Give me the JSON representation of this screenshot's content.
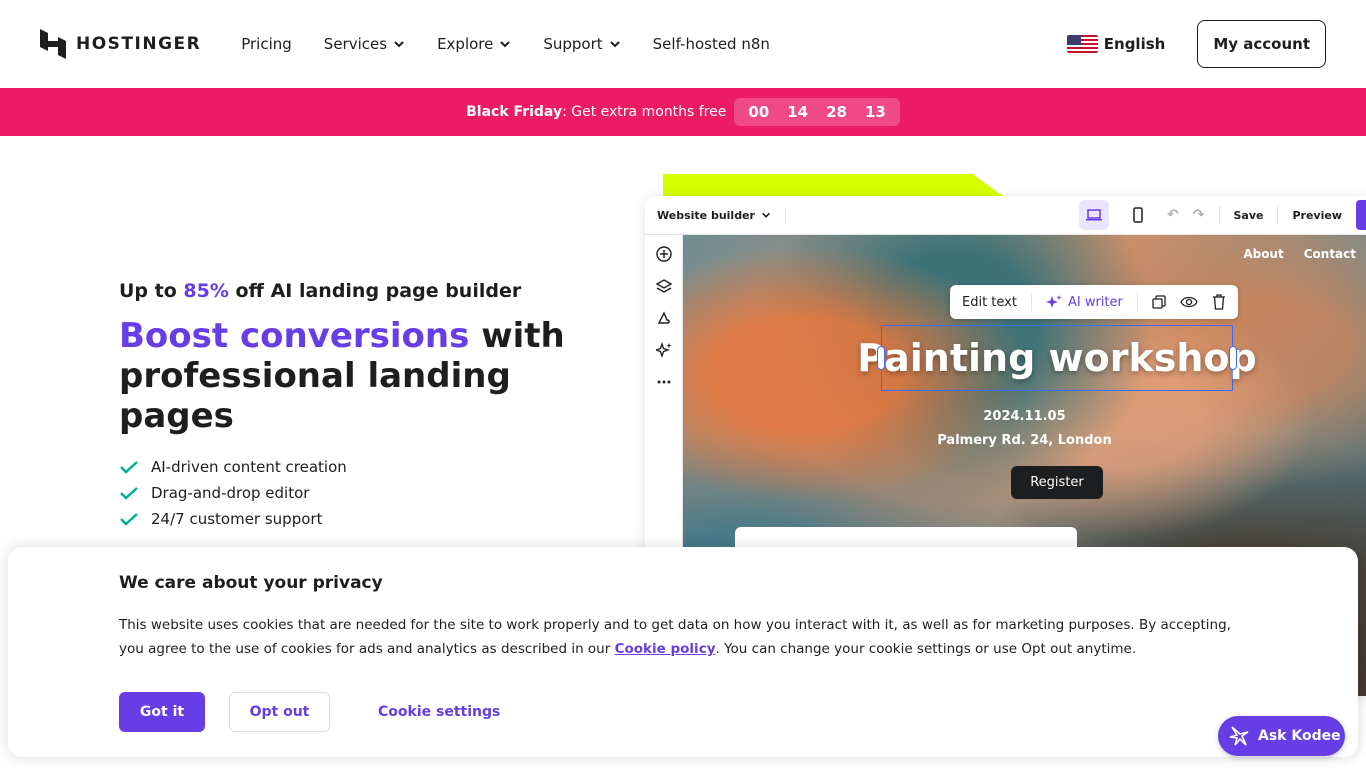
{
  "header": {
    "logo_text": "HOSTINGER",
    "nav": [
      {
        "label": "Pricing",
        "dropdown": false
      },
      {
        "label": "Services",
        "dropdown": true
      },
      {
        "label": "Explore",
        "dropdown": true
      },
      {
        "label": "Support",
        "dropdown": true
      },
      {
        "label": "Self-hosted n8n",
        "dropdown": false
      }
    ],
    "language": "English",
    "account_label": "My account"
  },
  "promo": {
    "bold": "Black Friday",
    "text": ": Get extra months free",
    "countdown": [
      "00",
      "14",
      "28",
      "13"
    ]
  },
  "hero": {
    "kicker_prefix": "Up to ",
    "kicker_accent": "85%",
    "kicker_suffix": " off AI landing page builder",
    "headline_accent": "Boost conversions",
    "headline_rest": " with professional landing pages",
    "features": [
      "AI-driven content creation",
      "Drag-and-drop editor",
      "24/7 customer support"
    ]
  },
  "builder": {
    "title": "Website builder",
    "save": "Save",
    "preview": "Preview",
    "canvas_nav": [
      "About",
      "Contact"
    ],
    "toolbar": {
      "edit_text": "Edit text",
      "ai_writer": "AI writer"
    },
    "event_title": "Painting workshop",
    "event_date": "2024.11.05",
    "event_location": "Palmery Rd. 24, London",
    "register": "Register"
  },
  "cookie": {
    "title": "We care about your privacy",
    "text_before": "This website uses cookies that are needed for the site to work properly and to get data on how you interact with it, as well as for marketing purposes. By accepting, you agree to the use of cookies for ads and analytics as described in our ",
    "link": "Cookie policy",
    "text_after": ". You can change your cookie settings or use Opt out anytime.",
    "got_it": "Got it",
    "opt_out": "Opt out",
    "settings": "Cookie settings"
  },
  "kodee": {
    "label": "Ask Kodee"
  },
  "colors": {
    "brand": "#673de6",
    "promo": "#ec1b64",
    "lime": "#d5ff00",
    "text": "#1d1e20"
  }
}
